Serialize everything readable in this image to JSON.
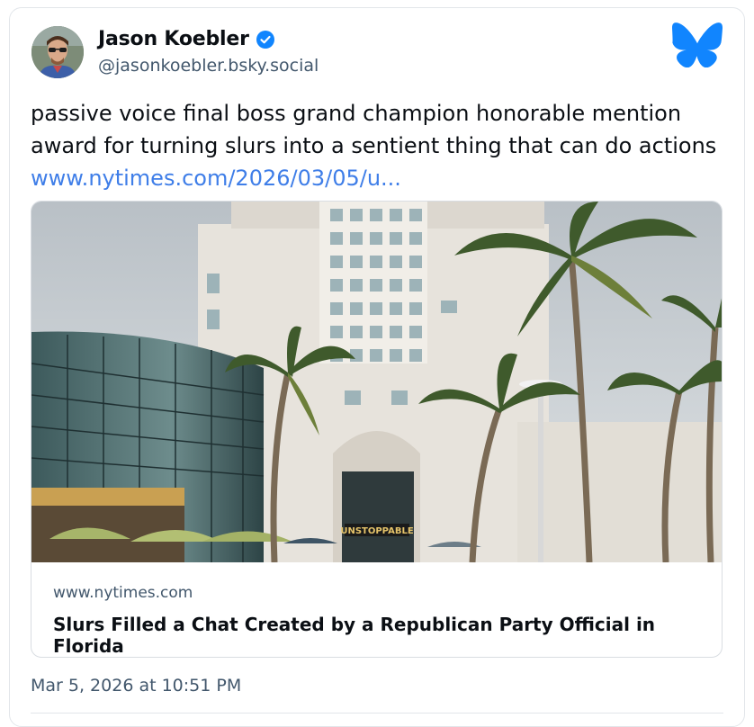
{
  "author": {
    "display_name": "Jason Koebler",
    "handle": "@jasonkoebler.bsky.social",
    "verified_icon": "verified-check-icon",
    "avatar_icon": "avatar"
  },
  "brand": {
    "logo_icon": "butterfly-icon",
    "color": "#1185fe"
  },
  "post": {
    "text": "passive voice final boss grand champion honorable mention award for turning slurs into a sentient thing that can do actions",
    "link_text": "www.nytimes.com/2026/03/05/u...",
    "link_color": "#3f7ee8"
  },
  "embed": {
    "image_description_icon": "news-photo",
    "sign_text": "UNSTOPPABLE",
    "domain": "www.nytimes.com",
    "title": "Slurs Filled a Chat Created by a Republican Party Official in Florida"
  },
  "timestamp": "Mar 5, 2026 at 10:51 PM",
  "colors": {
    "text": "#0b0f14",
    "muted": "#42576c",
    "border": "#e2e6ea"
  }
}
